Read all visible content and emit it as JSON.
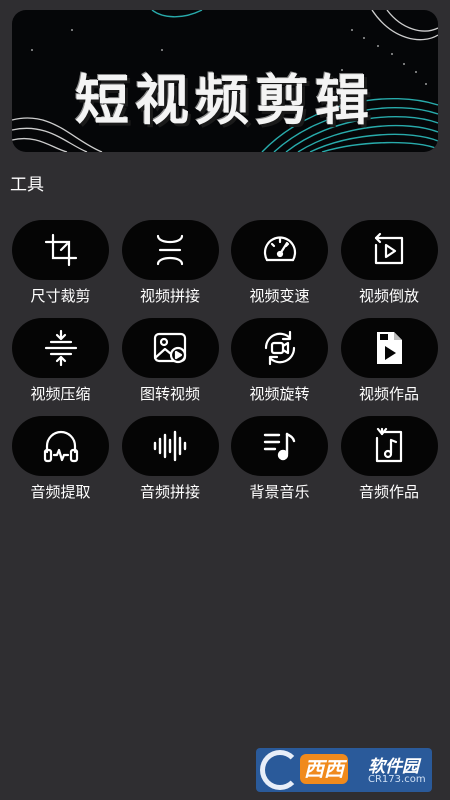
{
  "banner": {
    "title": "短视频剪辑"
  },
  "section": {
    "title": "工具"
  },
  "tools": [
    {
      "label": "尺寸裁剪",
      "icon": "crop-icon"
    },
    {
      "label": "视频拼接",
      "icon": "merge-icon"
    },
    {
      "label": "视频变速",
      "icon": "speedometer-icon"
    },
    {
      "label": "视频倒放",
      "icon": "reverse-play-icon"
    },
    {
      "label": "视频压缩",
      "icon": "compress-icon"
    },
    {
      "label": "图转视频",
      "icon": "image-to-video-icon"
    },
    {
      "label": "视频旋转",
      "icon": "rotate-video-icon"
    },
    {
      "label": "视频作品",
      "icon": "video-file-icon"
    },
    {
      "label": "音频提取",
      "icon": "headphones-icon"
    },
    {
      "label": "音频拼接",
      "icon": "audio-wave-icon"
    },
    {
      "label": "背景音乐",
      "icon": "music-list-icon"
    },
    {
      "label": "音频作品",
      "icon": "music-file-icon"
    }
  ],
  "watermark": {
    "badge": "西西",
    "text": "软件园",
    "url": "CR173.com"
  },
  "colors": {
    "background": "#2f2e31",
    "pill": "#050505",
    "accent_line": "#28c9c9"
  }
}
